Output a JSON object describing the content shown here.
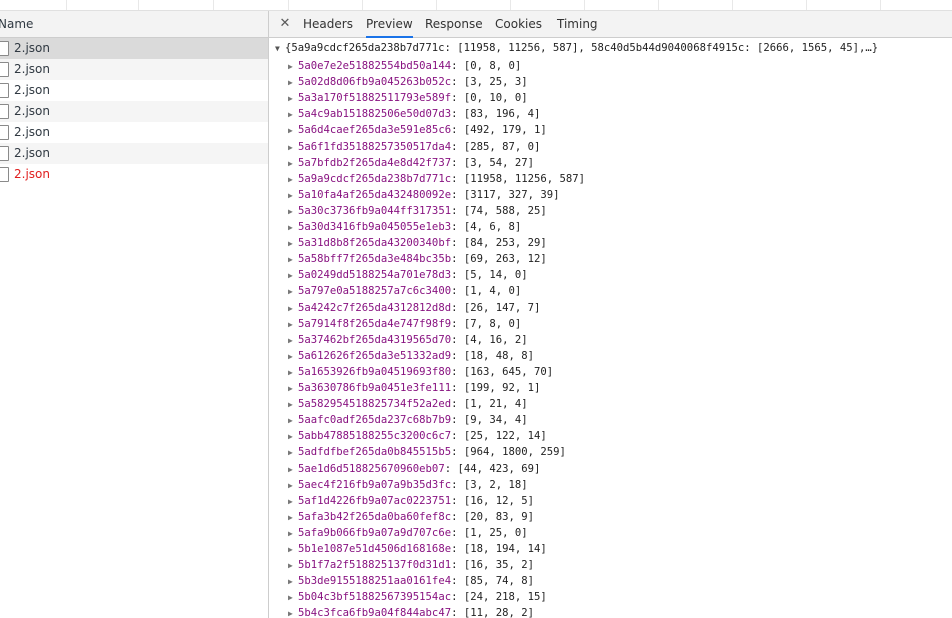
{
  "sidebar": {
    "header": "Name",
    "requests": [
      {
        "label": "2.json",
        "selected": true,
        "error": false
      },
      {
        "label": "2.json",
        "selected": false,
        "error": false
      },
      {
        "label": "2.json",
        "selected": false,
        "error": false
      },
      {
        "label": "2.json",
        "selected": false,
        "error": false
      },
      {
        "label": "2.json",
        "selected": false,
        "error": false
      },
      {
        "label": "2.json",
        "selected": false,
        "error": false
      },
      {
        "label": "2.json",
        "selected": false,
        "error": true
      }
    ]
  },
  "tabs": {
    "close_icon": "close-icon",
    "items": [
      "Headers",
      "Preview",
      "Response",
      "Cookies",
      "Timing"
    ],
    "active": "Preview"
  },
  "preview": {
    "root_summary": "{5a9a9cdcf265da238b7d771c: [11958, 11256, 587], 58c40d5b44d9040068f4915c: [2666, 1565, 45],…}",
    "entries": [
      {
        "key": "5a0e7e2e51882554bd50a144",
        "value": "[0, 8, 0]"
      },
      {
        "key": "5a02d8d06fb9a045263b052c",
        "value": "[3, 25, 3]"
      },
      {
        "key": "5a3a170f51882511793e589f",
        "value": "[0, 10, 0]"
      },
      {
        "key": "5a4c9ab151882506e50d07d3",
        "value": "[83, 196, 4]"
      },
      {
        "key": "5a6d4caef265da3e591e85c6",
        "value": "[492, 179, 1]"
      },
      {
        "key": "5a6f1fd35188257350517da4",
        "value": "[285, 87, 0]"
      },
      {
        "key": "5a7bfdb2f265da4e8d42f737",
        "value": "[3, 54, 27]"
      },
      {
        "key": "5a9a9cdcf265da238b7d771c",
        "value": "[11958, 11256, 587]"
      },
      {
        "key": "5a10fa4af265da432480092e",
        "value": "[3117, 327, 39]"
      },
      {
        "key": "5a30c3736fb9a044ff317351",
        "value": "[74, 588, 25]"
      },
      {
        "key": "5a30d3416fb9a045055e1eb3",
        "value": "[4, 6, 8]"
      },
      {
        "key": "5a31d8b8f265da43200340bf",
        "value": "[84, 253, 29]"
      },
      {
        "key": "5a58bff7f265da3e484bc35b",
        "value": "[69, 263, 12]"
      },
      {
        "key": "5a0249dd5188254a701e78d3",
        "value": "[5, 14, 0]"
      },
      {
        "key": "5a797e0a5188257a7c6c3400",
        "value": "[1, 4, 0]"
      },
      {
        "key": "5a4242c7f265da4312812d8d",
        "value": "[26, 147, 7]"
      },
      {
        "key": "5a7914f8f265da4e747f98f9",
        "value": "[7, 8, 0]"
      },
      {
        "key": "5a37462bf265da4319565d70",
        "value": "[4, 16, 2]"
      },
      {
        "key": "5a612626f265da3e51332ad9",
        "value": "[18, 48, 8]"
      },
      {
        "key": "5a1653926fb9a04519693f80",
        "value": "[163, 645, 70]"
      },
      {
        "key": "5a3630786fb9a0451e3fe111",
        "value": "[199, 92, 1]"
      },
      {
        "key": "5a582954518825734f52a2ed",
        "value": "[1, 21, 4]"
      },
      {
        "key": "5aafc0adf265da237c68b7b9",
        "value": "[9, 34, 4]"
      },
      {
        "key": "5abb47885188255c3200c6c7",
        "value": "[25, 122, 14]"
      },
      {
        "key": "5adfdfbef265da0b845515b5",
        "value": "[964, 1800, 259]"
      },
      {
        "key": "5ae1d6d518825670960eb07",
        "value": "[44, 423, 69]"
      },
      {
        "key": "5aec4f216fb9a07a9b35d3fc",
        "value": "[3, 2, 18]"
      },
      {
        "key": "5af1d4226fb9a07ac0223751",
        "value": "[16, 12, 5]"
      },
      {
        "key": "5afa3b42f265da0ba60fef8c",
        "value": "[20, 83, 9]"
      },
      {
        "key": "5afa9b066fb9a07a9d707c6e",
        "value": "[1, 25, 0]"
      },
      {
        "key": "5b1e1087e51d4506d168168e",
        "value": "[18, 194, 14]"
      },
      {
        "key": "5b1f7a2f518825137f0d31d1",
        "value": "[16, 35, 2]"
      },
      {
        "key": "5b3de9155188251aa0161fe4",
        "value": "[85, 74, 8]"
      },
      {
        "key": "5b04c3bf51882567395154ac",
        "value": "[24, 218, 15]"
      },
      {
        "key": "5b4c3fca6fb9a04f844abc47",
        "value": "[11, 28, 2]"
      }
    ]
  }
}
